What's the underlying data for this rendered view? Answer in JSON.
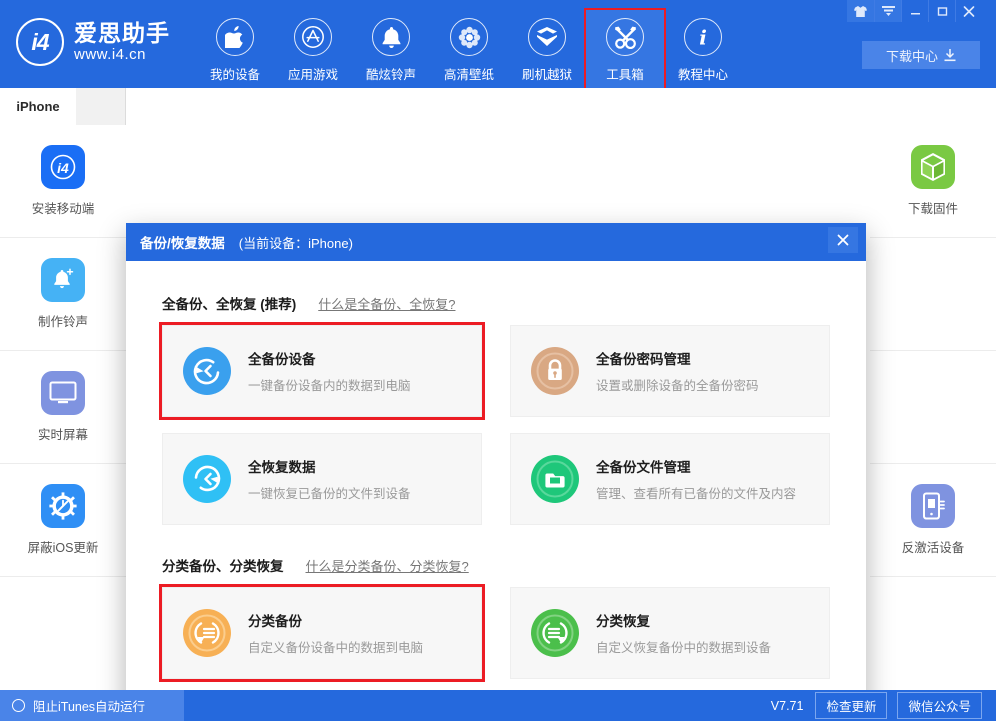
{
  "window": {
    "controls": [
      {
        "name": "skin-icon",
        "label": "skin"
      },
      {
        "name": "menu-icon",
        "label": "menu"
      },
      {
        "name": "minimize-icon",
        "label": "–"
      },
      {
        "name": "maximize-icon",
        "label": "▫"
      },
      {
        "name": "close-icon",
        "label": "✕"
      }
    ]
  },
  "brand": {
    "mark": "i4",
    "name_cn": "爱思助手",
    "url": "www.i4.cn"
  },
  "nav": {
    "items": [
      {
        "label": "我的设备",
        "icon": "apple-icon",
        "active": false,
        "highlight": false
      },
      {
        "label": "应用游戏",
        "icon": "appstore-icon",
        "active": false,
        "highlight": false
      },
      {
        "label": "酷炫铃声",
        "icon": "bell-icon",
        "active": false,
        "highlight": false
      },
      {
        "label": "高清壁纸",
        "icon": "flower-icon",
        "active": false,
        "highlight": false
      },
      {
        "label": "刷机越狱",
        "icon": "box-open-icon",
        "active": false,
        "highlight": false
      },
      {
        "label": "工具箱",
        "icon": "tools-icon",
        "active": true,
        "highlight": true
      },
      {
        "label": "教程中心",
        "icon": "info-icon",
        "active": false,
        "highlight": false
      }
    ],
    "download_center": "下载中心"
  },
  "tabs": {
    "device_tab": "iPhone"
  },
  "sidebar_left": {
    "items": [
      {
        "label": "安装移动端",
        "icon": "i4-app-icon",
        "color": "#1a6ef5"
      },
      {
        "label": "制作铃声",
        "icon": "bell-plus-icon",
        "color": "#45b2f5"
      },
      {
        "label": "实时屏幕",
        "icon": "monitor-icon",
        "color": "#7f93e0"
      },
      {
        "label": "屏蔽iOS更新",
        "icon": "block-update-icon",
        "color": "#2f8ff5"
      }
    ]
  },
  "sidebar_right": {
    "items": [
      {
        "label": "下载固件",
        "icon": "cube-icon",
        "color": "#7ac943"
      },
      {
        "label": "",
        "icon": "",
        "color": ""
      },
      {
        "label": "",
        "icon": "",
        "color": ""
      },
      {
        "label": "反激活设备",
        "icon": "device-deactivate-icon",
        "color": "#7f93e0"
      }
    ]
  },
  "dialog": {
    "title": "备份/恢复数据",
    "subtitle": "(当前设备：iPhone)",
    "close_label": "✕",
    "sections": [
      {
        "title": "全备份、全恢复 (推荐)",
        "link": "什么是全备份、全恢复?",
        "cards": [
          {
            "title": "全备份设备",
            "desc": "一键备份设备内的数据到电脑",
            "icon": "backup-device-icon",
            "color": "#3aa0ee",
            "highlight": true
          },
          {
            "title": "全备份密码管理",
            "desc": "设置或删除设备的全备份密码",
            "icon": "lock-icon",
            "color": "#d9a883",
            "highlight": false
          },
          {
            "title": "全恢复数据",
            "desc": "一键恢复已备份的文件到设备",
            "icon": "restore-data-icon",
            "color": "#2fc0f5",
            "highlight": false
          },
          {
            "title": "全备份文件管理",
            "desc": "管理、查看所有已备份的文件及内容",
            "icon": "folder-icon",
            "color": "#1ec77a",
            "highlight": false
          }
        ]
      },
      {
        "title": "分类备份、分类恢复",
        "link": "什么是分类备份、分类恢复?",
        "cards": [
          {
            "title": "分类备份",
            "desc": "自定义备份设备中的数据到电脑",
            "icon": "category-backup-icon",
            "color": "#f7b055",
            "highlight": true
          },
          {
            "title": "分类恢复",
            "desc": "自定义恢复备份中的数据到设备",
            "icon": "category-restore-icon",
            "color": "#4bbf4b",
            "highlight": false
          }
        ]
      }
    ]
  },
  "statusbar": {
    "itunes_label": "阻止iTunes自动运行",
    "version": "V7.71",
    "check_update": "检查更新",
    "wechat": "微信公众号"
  },
  "colors": {
    "brand_blue": "#2569dd",
    "accent_blue": "#3576e2",
    "highlight_red": "#ec1c24"
  }
}
